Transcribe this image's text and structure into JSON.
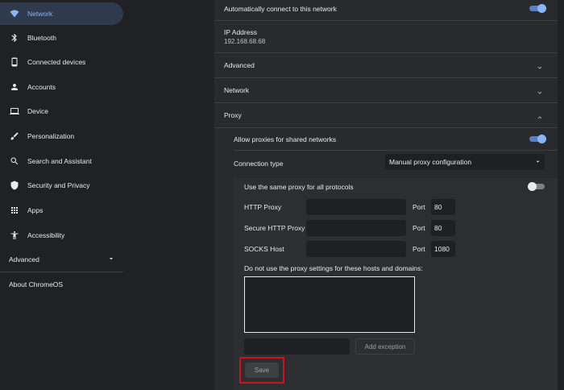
{
  "sidebar": {
    "items": [
      {
        "label": "Network",
        "icon": "wifi-icon",
        "active": true
      },
      {
        "label": "Bluetooth",
        "icon": "bluetooth-icon"
      },
      {
        "label": "Connected devices",
        "icon": "phone-icon"
      },
      {
        "label": "Accounts",
        "icon": "person-icon"
      },
      {
        "label": "Device",
        "icon": "laptop-icon"
      },
      {
        "label": "Personalization",
        "icon": "brush-icon"
      },
      {
        "label": "Search and Assistant",
        "icon": "search-icon"
      },
      {
        "label": "Security and Privacy",
        "icon": "shield-icon"
      },
      {
        "label": "Apps",
        "icon": "apps-grid-icon"
      },
      {
        "label": "Accessibility",
        "icon": "accessibility-icon"
      }
    ],
    "advanced_label": "Advanced",
    "about_label": "About ChromeOS"
  },
  "main": {
    "auto_connect_label": "Automatically connect to this network",
    "ip_label": "IP Address",
    "ip_value": "192.168.68.68",
    "advanced_label": "Advanced",
    "network_label": "Network",
    "proxy_label": "Proxy",
    "allow_proxies_label": "Allow proxies for shared networks",
    "connection_type_label": "Connection type",
    "connection_type_value": "Manual proxy configuration",
    "same_proxy_label": "Use the same proxy for all protocols",
    "http_proxy_label": "HTTP Proxy",
    "secure_http_proxy_label": "Secure HTTP Proxy",
    "socks_host_label": "SOCKS Host",
    "port_label": "Port",
    "http_port": "80",
    "secure_port": "80",
    "socks_port": "1080",
    "exceptions_label": "Do not use the proxy settings for these hosts and domains:",
    "add_exception_label": "Add exception",
    "save_label": "Save"
  },
  "colors": {
    "accent": "#8ab4f8",
    "highlight_border": "#d0121e",
    "panel_bg": "#292a2d",
    "page_bg": "#202124"
  }
}
